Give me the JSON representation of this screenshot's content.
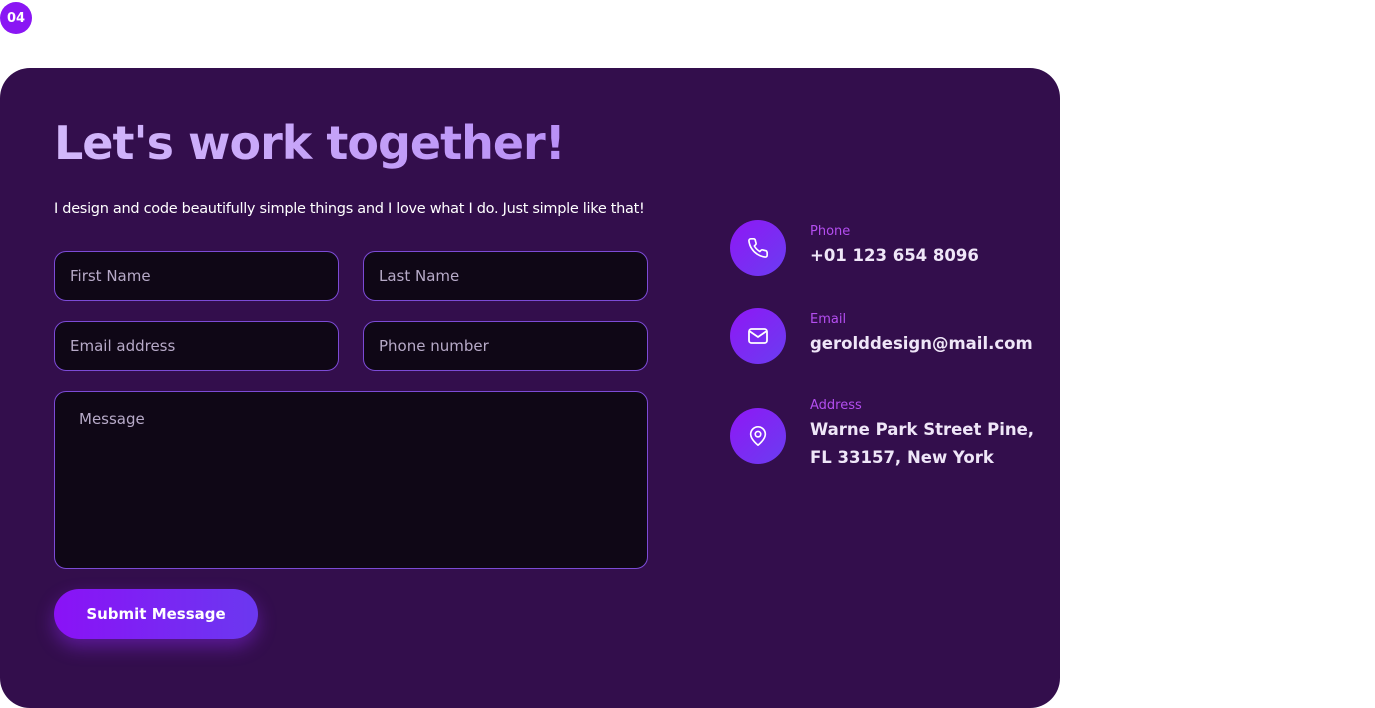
{
  "badge": "04",
  "contact": {
    "heading": "Let's work together!",
    "subtitle": "I design and code beautifully simple things and I love what I do. Just simple like that!",
    "form": {
      "first_name_placeholder": "First Name",
      "last_name_placeholder": "Last Name",
      "email_placeholder": "Email address",
      "phone_placeholder": "Phone number",
      "message_placeholder": "Message",
      "submit_label": "Submit Message"
    },
    "info": {
      "phone": {
        "label": "Phone",
        "value": "+01 123 654 8096",
        "icon": "phone-icon"
      },
      "email": {
        "label": "Email",
        "value": "gerolddesign@mail.com",
        "icon": "mail-icon"
      },
      "address": {
        "label": "Address",
        "line1": "Warne Park Street Pine,",
        "line2": "FL 33157, New York",
        "icon": "map-pin-icon"
      }
    }
  },
  "colors": {
    "card_background": "#330e4c",
    "accent": "#8a16f4",
    "label_accent": "#b44ef0",
    "heading": "#c8a8f8"
  }
}
